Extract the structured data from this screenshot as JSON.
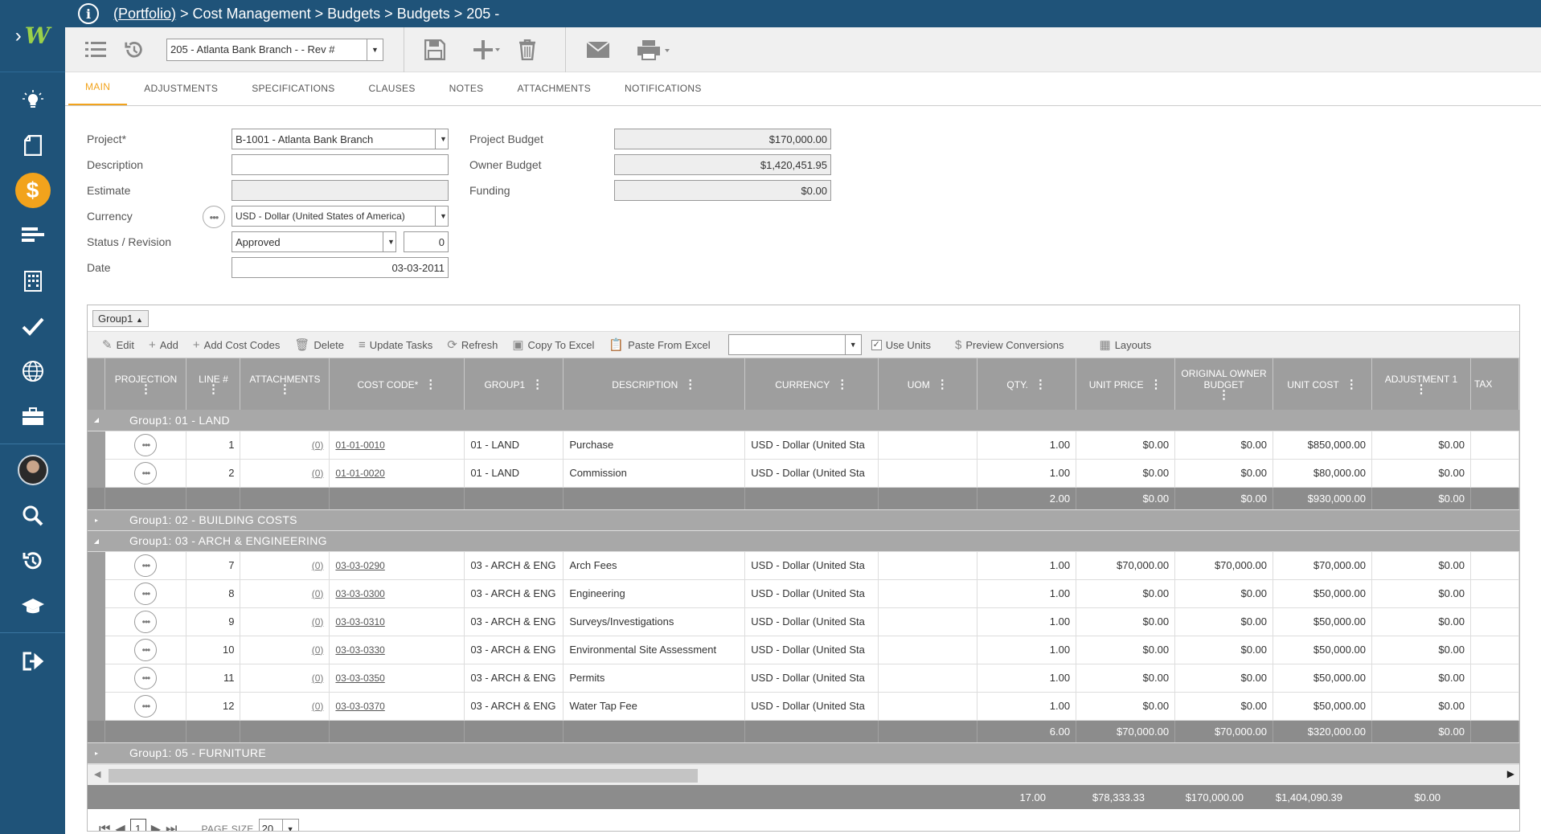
{
  "app": {
    "logo_text": "W"
  },
  "breadcrumb": {
    "portfolio": "(Portfolio)",
    "rest": " > Cost Management > Budgets > Budgets > 205 -"
  },
  "toolbar": {
    "record_select": "205 - Atlanta Bank Branch -  - Rev #"
  },
  "tabs": [
    "MAIN",
    "ADJUSTMENTS",
    "SPECIFICATIONS",
    "CLAUSES",
    "NOTES",
    "ATTACHMENTS",
    "NOTIFICATIONS"
  ],
  "form": {
    "project_label": "Project*",
    "project_value": "B-1001 - Atlanta Bank Branch",
    "description_label": "Description",
    "description_value": "",
    "estimate_label": "Estimate",
    "estimate_value": "",
    "currency_label": "Currency",
    "currency_value": "USD - Dollar (United States of America)",
    "status_label": "Status / Revision",
    "status_value": "Approved",
    "revision_value": "0",
    "date_label": "Date",
    "date_value": "03-03-2011",
    "project_budget_label": "Project Budget",
    "project_budget_value": "$170,000.00",
    "owner_budget_label": "Owner Budget",
    "owner_budget_value": "$1,420,451.95",
    "funding_label": "Funding",
    "funding_value": "$0.00"
  },
  "grid": {
    "group_tag": "Group1",
    "toolbar": {
      "edit": "Edit",
      "add": "Add",
      "add_cost_codes": "Add Cost Codes",
      "delete": "Delete",
      "update_tasks": "Update Tasks",
      "refresh": "Refresh",
      "copy_to_excel": "Copy To Excel",
      "paste_from_excel": "Paste From Excel",
      "use_units": "Use Units",
      "preview_conversions": "Preview Conversions",
      "layouts": "Layouts"
    },
    "columns": [
      "PROJECTION",
      "LINE #",
      "ATTACHMENTS",
      "COST CODE*",
      "GROUP1",
      "DESCRIPTION",
      "CURRENCY",
      "UOM",
      "QTY.",
      "UNIT PRICE",
      "ORIGINAL OWNER BUDGET",
      "UNIT COST",
      "ADJUSTMENT 1",
      "TAX"
    ],
    "groups": [
      {
        "title": "Group1: 01 - LAND",
        "expanded": true,
        "rows": [
          {
            "line": "1",
            "att": "(0)",
            "code": "01-01-0010",
            "group": "01 - LAND",
            "desc": "Purchase",
            "currency": "USD - Dollar (United Sta",
            "uom": "",
            "qty": "1.00",
            "unit_price": "$0.00",
            "oob": "$0.00",
            "unit_cost": "$850,000.00",
            "adj1": "$0.00"
          },
          {
            "line": "2",
            "att": "(0)",
            "code": "01-01-0020",
            "group": "01 - LAND",
            "desc": "Commission",
            "currency": "USD - Dollar (United Sta",
            "uom": "",
            "qty": "1.00",
            "unit_price": "$0.00",
            "oob": "$0.00",
            "unit_cost": "$80,000.00",
            "adj1": "$0.00"
          }
        ],
        "totals": {
          "qty": "2.00",
          "unit_price": "$0.00",
          "oob": "$0.00",
          "unit_cost": "$930,000.00",
          "adj1": "$0.00"
        }
      },
      {
        "title": "Group1: 02 - BUILDING COSTS",
        "expanded": false,
        "rows": []
      },
      {
        "title": "Group1: 03 - ARCH & ENGINEERING",
        "expanded": true,
        "rows": [
          {
            "line": "7",
            "att": "(0)",
            "code": "03-03-0290",
            "group": "03 - ARCH & ENG",
            "desc": "Arch Fees",
            "currency": "USD - Dollar (United Sta",
            "uom": "",
            "qty": "1.00",
            "unit_price": "$70,000.00",
            "oob": "$70,000.00",
            "unit_cost": "$70,000.00",
            "adj1": "$0.00"
          },
          {
            "line": "8",
            "att": "(0)",
            "code": "03-03-0300",
            "group": "03 - ARCH & ENG",
            "desc": "Engineering",
            "currency": "USD - Dollar (United Sta",
            "uom": "",
            "qty": "1.00",
            "unit_price": "$0.00",
            "oob": "$0.00",
            "unit_cost": "$50,000.00",
            "adj1": "$0.00"
          },
          {
            "line": "9",
            "att": "(0)",
            "code": "03-03-0310",
            "group": "03 - ARCH & ENG",
            "desc": "Surveys/Investigations",
            "currency": "USD - Dollar (United Sta",
            "uom": "",
            "qty": "1.00",
            "unit_price": "$0.00",
            "oob": "$0.00",
            "unit_cost": "$50,000.00",
            "adj1": "$0.00"
          },
          {
            "line": "10",
            "att": "(0)",
            "code": "03-03-0330",
            "group": "03 - ARCH & ENG",
            "desc": "Environmental Site Assessment",
            "currency": "USD - Dollar (United Sta",
            "uom": "",
            "qty": "1.00",
            "unit_price": "$0.00",
            "oob": "$0.00",
            "unit_cost": "$50,000.00",
            "adj1": "$0.00"
          },
          {
            "line": "11",
            "att": "(0)",
            "code": "03-03-0350",
            "group": "03 - ARCH & ENG",
            "desc": "Permits",
            "currency": "USD - Dollar (United Sta",
            "uom": "",
            "qty": "1.00",
            "unit_price": "$0.00",
            "oob": "$0.00",
            "unit_cost": "$50,000.00",
            "adj1": "$0.00"
          },
          {
            "line": "12",
            "att": "(0)",
            "code": "03-03-0370",
            "group": "03 - ARCH & ENG",
            "desc": "Water Tap Fee",
            "currency": "USD - Dollar (United Sta",
            "uom": "",
            "qty": "1.00",
            "unit_price": "$0.00",
            "oob": "$0.00",
            "unit_cost": "$50,000.00",
            "adj1": "$0.00"
          }
        ],
        "totals": {
          "qty": "6.00",
          "unit_price": "$70,000.00",
          "oob": "$70,000.00",
          "unit_cost": "$320,000.00",
          "adj1": "$0.00"
        }
      },
      {
        "title": "Group1: 05 - FURNITURE",
        "expanded": false,
        "rows": []
      }
    ],
    "grand_totals": {
      "qty": "17.00",
      "unit_price": "$78,333.33",
      "oob": "$170,000.00",
      "unit_cost": "$1,404,090.39",
      "adj1": "$0.00"
    },
    "pager": {
      "page": "1",
      "page_size_label": "PAGE SIZE",
      "page_size": "20"
    }
  },
  "colors": {
    "sidebar": "#1f5379",
    "accent": "#f2a31c",
    "header_gray": "#9e9e9e"
  }
}
